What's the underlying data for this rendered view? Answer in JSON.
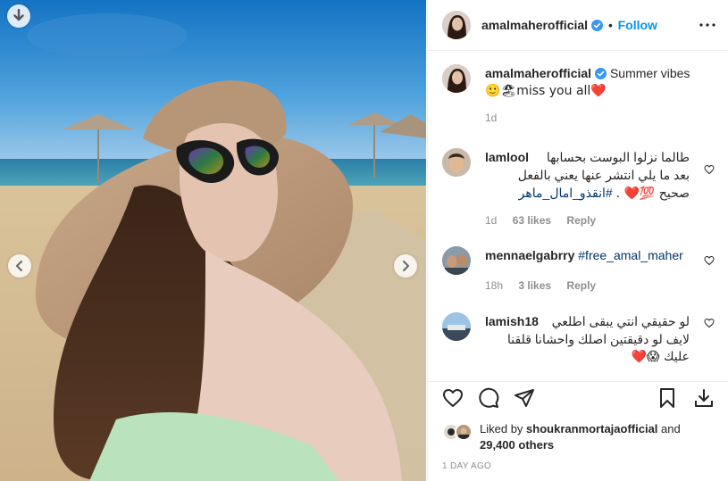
{
  "post": {
    "username": "amalmaherofficial",
    "follow_label": "Follow",
    "separator": "•",
    "caption_text": "Summer vibes",
    "caption_line2": "🙂🏖miss you all❤️",
    "caption_time": "1d"
  },
  "comments": [
    {
      "username": "lamlool",
      "text_line1": "طالما نزلوا البوست بحسابها",
      "text_line2": "بعد ما يلي انتشر عنها يعني بالفعل",
      "text_line3": "صحيح 💯❤️ .",
      "hashtag": "#انقذو_امال_ماهر",
      "time": "1d",
      "likes": "63 likes",
      "reply": "Reply"
    },
    {
      "username": "mennaelgabrry",
      "hashtag": "#free_amal_maher",
      "time": "18h",
      "likes": "3 likes",
      "reply": "Reply"
    },
    {
      "username": "lamish18",
      "text_line1": "لو حقيقي انتي يبقى اطلعي",
      "text_line2": "لايف لو دقيقتين اصلك واحشانا قلقنا",
      "text_line3": "عليك 😱❤️"
    }
  ],
  "likes": {
    "prefix": "Liked by",
    "user": "shoukranmortajaofficial",
    "and": "and",
    "count": "29,400 others"
  },
  "timestamp": "1 DAY AGO",
  "colors": {
    "link_blue": "#0095f6",
    "verified_blue": "#3897f0",
    "heart_red": "#ed4956",
    "muted": "#8e8e8e"
  },
  "icons": [
    "download-icon",
    "chevron-left-icon",
    "chevron-right-icon",
    "verified-badge-icon",
    "more-options-icon",
    "heart-icon",
    "comment-icon",
    "share-icon",
    "save-icon",
    "download-icon"
  ]
}
